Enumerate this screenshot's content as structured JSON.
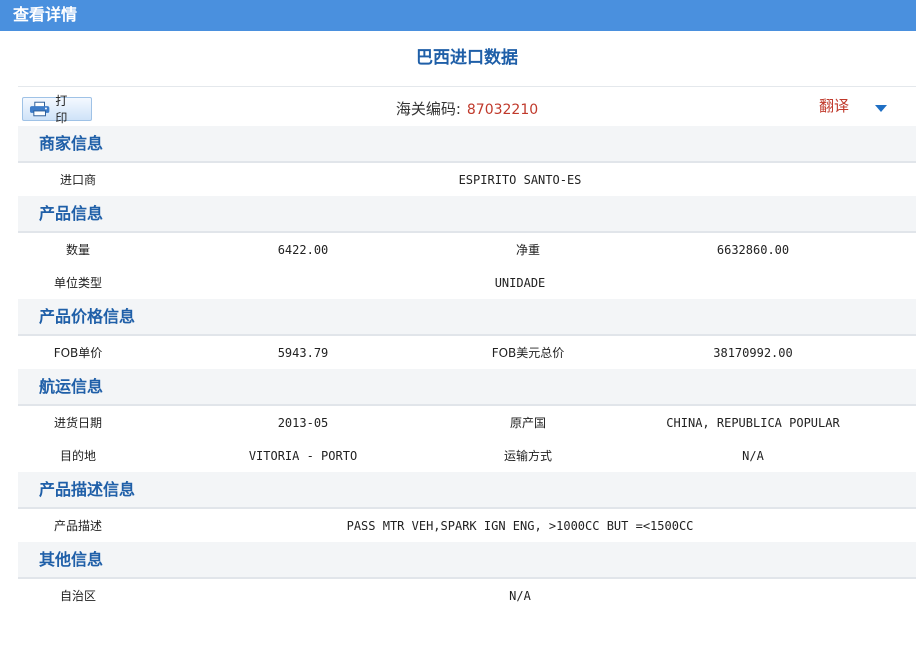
{
  "window": {
    "title": "查看详情"
  },
  "document": {
    "title": "巴西进口数据"
  },
  "toolbar": {
    "print_label": "打 印",
    "customs_label": "海关编码:",
    "customs_code": "87032210",
    "translate_label": "翻译"
  },
  "sections": {
    "merchant": {
      "title": "商家信息",
      "importer_label": "进口商",
      "importer_value": "ESPIRITO SANTO-ES"
    },
    "product": {
      "title": "产品信息",
      "quantity_label": "数量",
      "quantity_value": "6422.00",
      "net_weight_label": "净重",
      "net_weight_value": "6632860.00",
      "unit_type_label": "单位类型",
      "unit_type_value": "UNIDADE"
    },
    "price": {
      "title": "产品价格信息",
      "fob_unit_label": "FOB单价",
      "fob_unit_value": "5943.79",
      "fob_total_label": "FOB美元总价",
      "fob_total_value": "38170992.00"
    },
    "shipping": {
      "title": "航运信息",
      "date_label": "进货日期",
      "date_value": "2013-05",
      "origin_label": "原产国",
      "origin_value": "CHINA, REPUBLICA POPULAR",
      "destination_label": "目的地",
      "destination_value": "VITORIA - PORTO",
      "transport_label": "运输方式",
      "transport_value": "N/A"
    },
    "description": {
      "title": "产品描述信息",
      "desc_label": "产品描述",
      "desc_value": "PASS MTR VEH,SPARK IGN ENG, >1000CC BUT =<1500CC"
    },
    "other": {
      "title": "其他信息",
      "region_label": "自治区",
      "region_value": "N/A"
    }
  },
  "colors": {
    "topbar": "#4a90de",
    "title_blue": "#1f5fa8",
    "highlight_red": "#c0392b",
    "section_bg": "#f3f5f7"
  },
  "icons": {
    "print": "printer-icon",
    "dropdown": "triangle-down-icon"
  }
}
